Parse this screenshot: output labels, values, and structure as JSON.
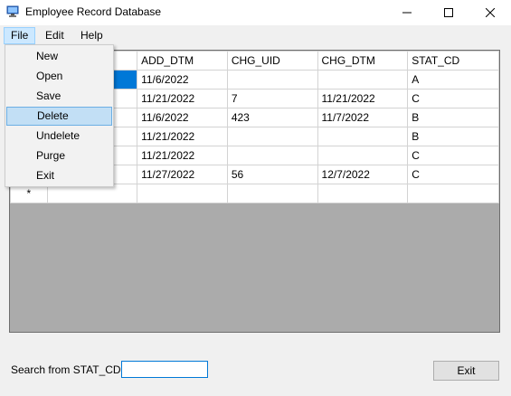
{
  "window": {
    "title": "Employee Record Database",
    "icon": "app-icon"
  },
  "menubar": {
    "items": [
      "File",
      "Edit",
      "Help"
    ]
  },
  "file_menu": {
    "items": [
      "New",
      "Open",
      "Save",
      "Delete",
      "Undelete",
      "Purge",
      "Exit"
    ],
    "highlighted": "Delete"
  },
  "grid": {
    "columns": [
      "",
      "ADD_DTM",
      "CHG_UID",
      "CHG_DTM",
      "STAT_CD"
    ],
    "rows": [
      [
        "",
        "11/6/2022",
        "",
        "",
        "A"
      ],
      [
        "",
        "11/21/2022",
        "7",
        "11/21/2022",
        "C"
      ],
      [
        "",
        "11/6/2022",
        "423",
        "11/7/2022",
        "B"
      ],
      [
        "",
        "11/21/2022",
        "",
        "",
        "B"
      ],
      [
        "",
        "11/21/2022",
        "",
        "",
        "C"
      ],
      [
        "",
        "11/27/2022",
        "56",
        "12/7/2022",
        "C"
      ]
    ],
    "new_row_marker": "*"
  },
  "search": {
    "label": "Search from STAT_CD:",
    "value": ""
  },
  "exit_button": {
    "label": "Exit"
  },
  "colors": {
    "accent": "#0078d7",
    "menu_hover": "#cce8ff",
    "grid_background": "#ababab"
  }
}
